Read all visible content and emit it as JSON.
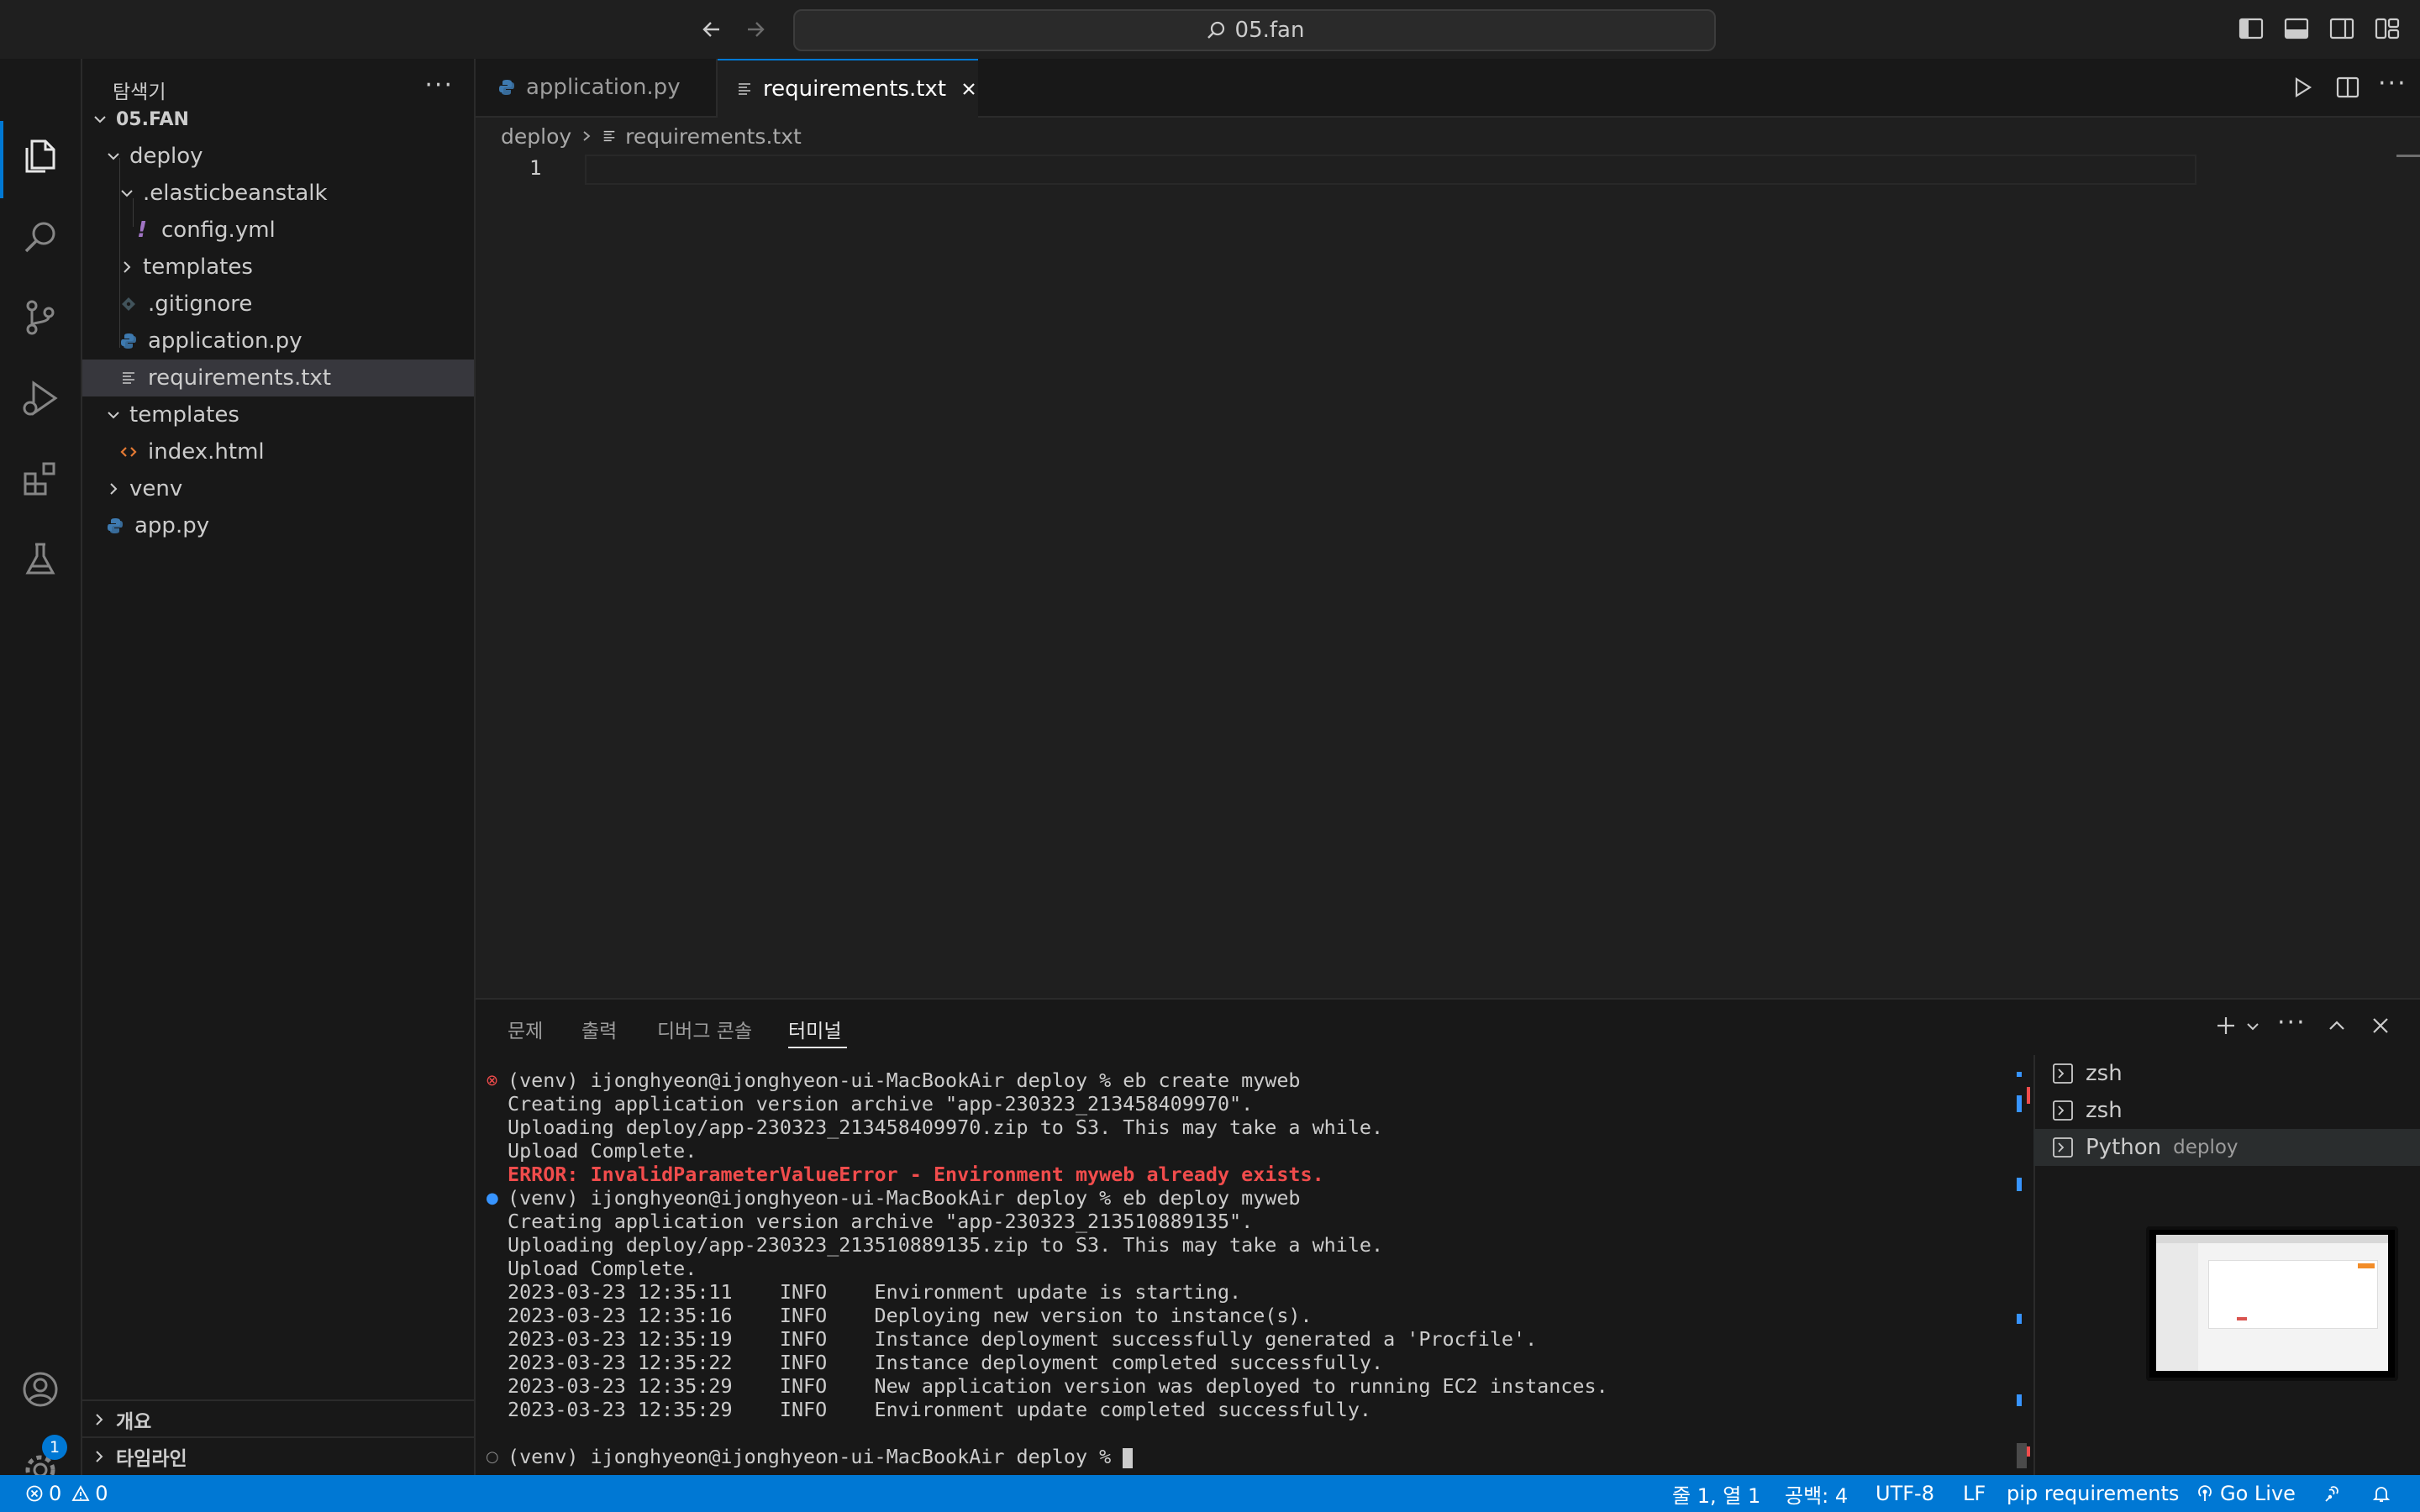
{
  "titlebar": {
    "search_text": "05.fan"
  },
  "sidebar": {
    "title": "탐색기",
    "root": "05.FAN",
    "tree": [
      {
        "label": "deploy"
      },
      {
        "label": ".elasticbeanstalk"
      },
      {
        "label": "config.yml"
      },
      {
        "label": "templates"
      },
      {
        "label": ".gitignore"
      },
      {
        "label": "application.py"
      },
      {
        "label": "requirements.txt"
      },
      {
        "label": "templates"
      },
      {
        "label": "index.html"
      },
      {
        "label": "venv"
      },
      {
        "label": "app.py"
      }
    ],
    "outline_label": "개요",
    "timeline_label": "타임라인"
  },
  "tabs": [
    {
      "label": "application.py"
    },
    {
      "label": "requirements.txt"
    }
  ],
  "breadcrumb": {
    "folder": "deploy",
    "file": "requirements.txt"
  },
  "editor": {
    "line_number": "1"
  },
  "panel": {
    "tabs": [
      "문제",
      "출력",
      "디버그 콘솔",
      "터미널"
    ],
    "terminal_lines": [
      "(venv) ijonghyeon@ijonghyeon-ui-MacBookAir deploy % eb create myweb",
      "Creating application version archive \"app-230323_213458409970\".",
      "Uploading deploy/app-230323_213458409970.zip to S3. This may take a while.",
      "Upload Complete.",
      "ERROR: InvalidParameterValueError - Environment myweb already exists.",
      "(venv) ijonghyeon@ijonghyeon-ui-MacBookAir deploy % eb deploy myweb",
      "Creating application version archive \"app-230323_213510889135\".",
      "Uploading deploy/app-230323_213510889135.zip to S3. This may take a while.",
      "Upload Complete.",
      "2023-03-23 12:35:11    INFO    Environment update is starting.",
      "2023-03-23 12:35:16    INFO    Deploying new version to instance(s).",
      "2023-03-23 12:35:19    INFO    Instance deployment successfully generated a 'Procfile'.",
      "2023-03-23 12:35:22    INFO    Instance deployment completed successfully.",
      "2023-03-23 12:35:29    INFO    New application version was deployed to running EC2 instances.",
      "2023-03-23 12:35:29    INFO    Environment update completed successfully."
    ],
    "prompt": "(venv) ijonghyeon@ijonghyeon-ui-MacBookAir deploy % ",
    "terminals": [
      {
        "name": "zsh",
        "detail": ""
      },
      {
        "name": "zsh",
        "detail": ""
      },
      {
        "name": "Python",
        "detail": "deploy"
      }
    ]
  },
  "statusbar": {
    "errors": "0",
    "warnings": "0",
    "position": "줄 1, 열 1",
    "spaces": "공백: 4",
    "encoding": "UTF-8",
    "eol": "LF",
    "language": "pip requirements",
    "golive": "Go Live"
  },
  "activity": {
    "badge": "1"
  },
  "colors": {
    "accent": "#0078d4",
    "error": "#f14c4c",
    "background": "#1f1f1f"
  }
}
